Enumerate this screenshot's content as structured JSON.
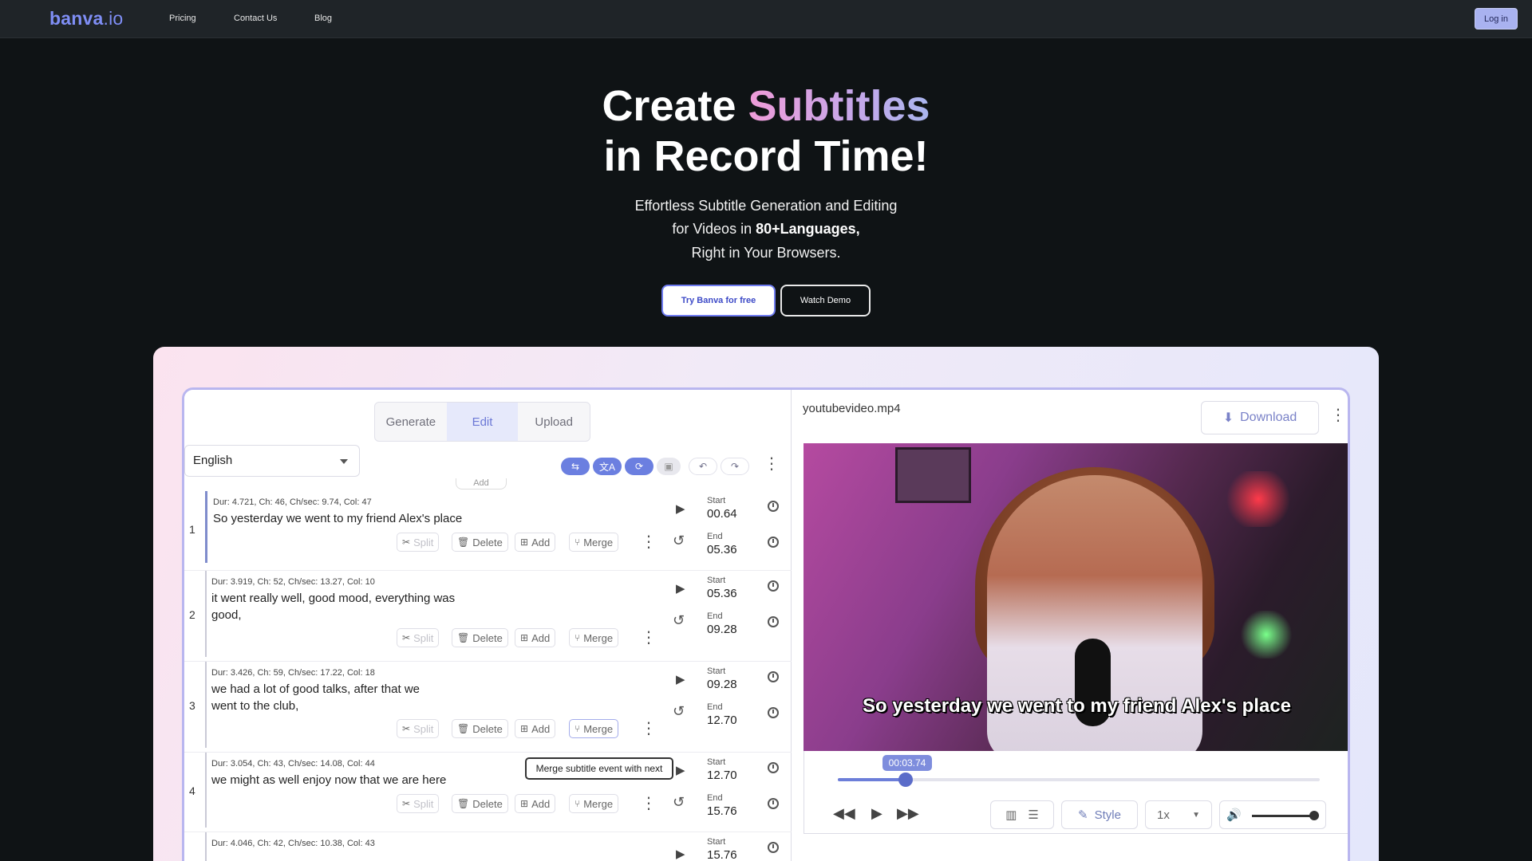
{
  "nav": {
    "logo_main": "banva",
    "logo_suffix": ".io",
    "links": [
      "Pricing",
      "Contact Us",
      "Blog"
    ],
    "login": "Log in"
  },
  "hero": {
    "title_part1": "Create ",
    "title_highlight": "Subtitles",
    "title_line2": "in Record Time!",
    "sub_line1": "Effortless Subtitle Generation and Editing",
    "sub_line2_prefix": "for Videos in ",
    "sub_line2_bold": "80+Languages,",
    "sub_line3": "Right in Your Browsers.",
    "cta_primary": "Try Banva for free",
    "cta_secondary": "Watch Demo"
  },
  "editor": {
    "tabs": [
      "Generate",
      "Edit",
      "Upload"
    ],
    "active_tab": "Edit",
    "language": "English",
    "add_stub": "Add",
    "actions": {
      "split": "Split",
      "delete": "Delete",
      "add": "Add",
      "merge": "Merge"
    },
    "start_label": "Start",
    "end_label": "End",
    "tooltip": "Merge subtitle event with next",
    "rows": [
      {
        "num": "1",
        "meta": "Dur: 4.721, Ch: 46, Ch/sec: 9.74, Col: 47",
        "text": "So yesterday we went to my friend Alex's place",
        "start": "00.64",
        "end": "05.36"
      },
      {
        "num": "2",
        "meta": "Dur: 3.919, Ch: 52, Ch/sec: 13.27, Col: 10",
        "text": "it went really well, good mood, everything was good,",
        "start": "05.36",
        "end": "09.28"
      },
      {
        "num": "3",
        "meta": "Dur: 3.426, Ch: 59, Ch/sec: 17.22, Col: 18",
        "text": "we had a lot of good talks, after that we went to the club,",
        "start": "09.28",
        "end": "12.70"
      },
      {
        "num": "4",
        "meta": "Dur: 3.054, Ch: 43, Ch/sec: 14.08, Col: 44",
        "text": "we might as well enjoy now that we are here",
        "start": "12.70",
        "end": "15.76"
      },
      {
        "num": "",
        "meta": "Dur: 4.046, Ch: 42, Ch/sec: 10.38, Col: 43",
        "text": "",
        "start": "15.76",
        "end": ""
      }
    ]
  },
  "preview": {
    "filename": "youtubevideo.mp4",
    "download": "Download",
    "caption": "So yesterday we went to my friend Alex's place",
    "current_time": "00:03.74",
    "progress": 0.14,
    "volume": 1.0,
    "style_label": "Style",
    "speed": "1x"
  },
  "colors": {
    "accent": "#6c7ed9",
    "logo": "#7f8ef5",
    "page_bg": "#0f1315"
  }
}
